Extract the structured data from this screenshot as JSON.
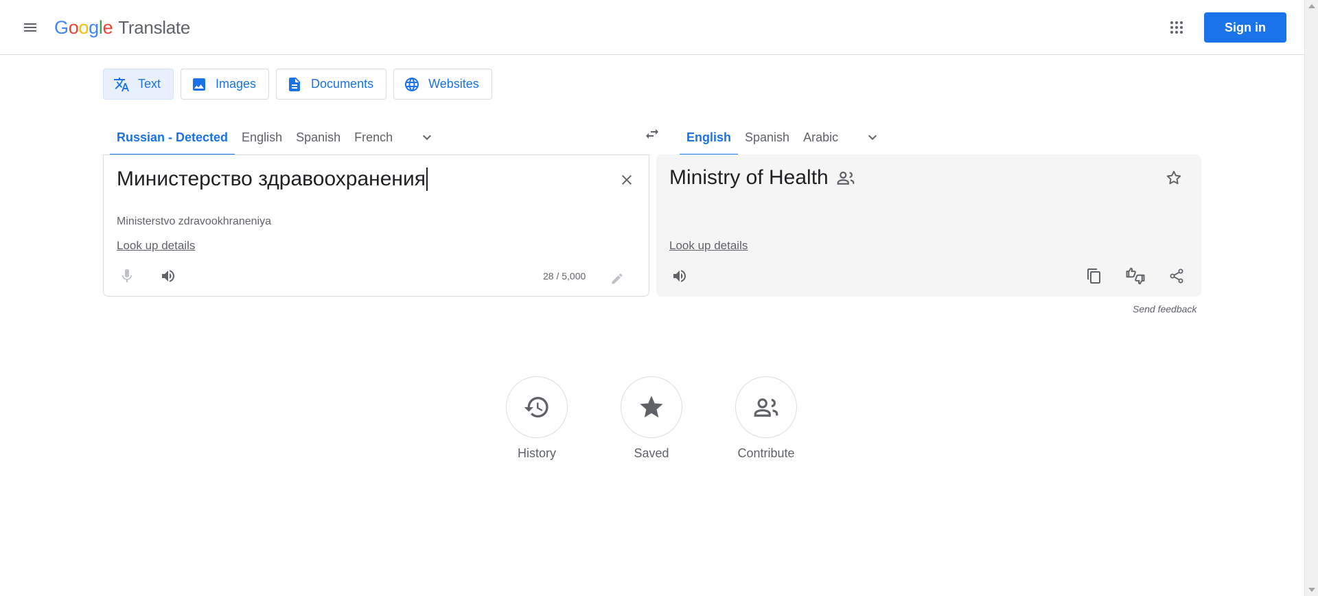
{
  "header": {
    "menu_icon": "hamburger-menu-icon",
    "logo": {
      "google_letters": [
        {
          "char": "G",
          "color": "#4285f4"
        },
        {
          "char": "o",
          "color": "#ea4335"
        },
        {
          "char": "o",
          "color": "#fbbc04"
        },
        {
          "char": "g",
          "color": "#4285f4"
        },
        {
          "char": "l",
          "color": "#34a853"
        },
        {
          "char": "e",
          "color": "#ea4335"
        }
      ],
      "product": "Translate"
    },
    "apps_icon": "apps-grid-icon",
    "sign_in_label": "Sign in",
    "accent_color": "#1a73e8"
  },
  "mode_tabs": [
    {
      "label": "Text",
      "icon": "translate-icon",
      "active": true
    },
    {
      "label": "Images",
      "icon": "image-icon",
      "active": false
    },
    {
      "label": "Documents",
      "icon": "document-icon",
      "active": false
    },
    {
      "label": "Websites",
      "icon": "globe-icon",
      "active": false
    }
  ],
  "source": {
    "languages": [
      "Russian - Detected",
      "English",
      "Spanish",
      "French"
    ],
    "active_index": 0,
    "text": "Министерство здравоохранения",
    "transliteration": "Ministerstvo zdravookhraneniya",
    "look_up_label": "Look up details",
    "char_count": "28 / 5,000"
  },
  "target": {
    "languages": [
      "English",
      "Spanish",
      "Arabic"
    ],
    "active_index": 0,
    "text": "Ministry of Health",
    "look_up_label": "Look up details"
  },
  "send_feedback": "Send feedback",
  "bottom_actions": [
    {
      "label": "History",
      "icon": "history-icon"
    },
    {
      "label": "Saved",
      "icon": "star-filled-icon"
    },
    {
      "label": "Contribute",
      "icon": "people-icon"
    }
  ]
}
